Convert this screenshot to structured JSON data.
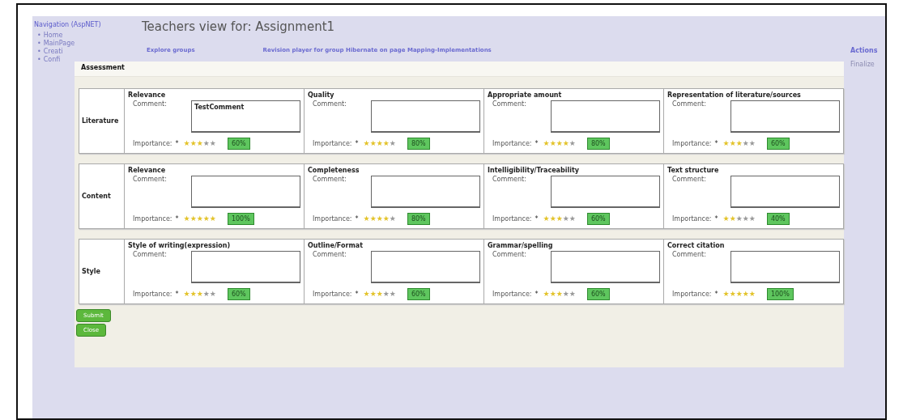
{
  "sidebar": {
    "title": "Navigation (AspNET)",
    "items": [
      {
        "bullet": "•",
        "label": "Home"
      },
      {
        "bullet": "•",
        "label": "MainPage"
      },
      {
        "bullet": "•",
        "label": "Creati"
      },
      {
        "bullet": "•",
        "label": "Confi"
      }
    ]
  },
  "page_title": "Teachers view for: Assignment1",
  "nav_links": [
    "Explore groups",
    "Revision player for group Hibernate on page Mapping-Implementations"
  ],
  "actions": {
    "title": "Actions",
    "items": [
      "Finalize"
    ]
  },
  "dialog": {
    "title": "Assessment",
    "rows": [
      {
        "category": "Literature",
        "criteria": [
          {
            "name": "Relevance",
            "comment_label": "Comment:",
            "comment": "TestComment",
            "importance_label": "Importance:",
            "required_mark": "*",
            "stars": 3,
            "percent": "60%"
          },
          {
            "name": "Quality",
            "comment_label": "Comment:",
            "importance_label": "Importance:",
            "required_mark": "*",
            "stars": 4,
            "percent": "80%"
          },
          {
            "name": "Appropriate amount",
            "comment_label": "Comment:",
            "importance_label": "Importance:",
            "required_mark": "*",
            "stars": 4,
            "percent": "80%"
          },
          {
            "name": "Representation of literature/sources",
            "comment_label": "Comment:",
            "importance_label": "Importance:",
            "required_mark": "*",
            "stars": 3,
            "percent": "60%"
          }
        ]
      },
      {
        "category": "Content",
        "criteria": [
          {
            "name": "Relevance",
            "comment_label": "Comment:",
            "importance_label": "Importance:",
            "required_mark": "*",
            "stars": 5,
            "percent": "100%"
          },
          {
            "name": "Completeness",
            "comment_label": "Comment:",
            "importance_label": "Importance:",
            "required_mark": "*",
            "stars": 4,
            "percent": "80%"
          },
          {
            "name": "Intelligibility/Traceability",
            "comment_label": "Comment:",
            "importance_label": "Importance:",
            "required_mark": "*",
            "stars": 3,
            "percent": "60%"
          },
          {
            "name": "Text structure",
            "comment_label": "Comment:",
            "importance_label": "Importance:",
            "required_mark": "*",
            "stars": 2,
            "percent": "40%"
          }
        ]
      },
      {
        "category": "Style",
        "criteria": [
          {
            "name": "Style of writing(expression)",
            "comment_label": "Comment:",
            "importance_label": "Importance:",
            "required_mark": "*",
            "stars": 3,
            "percent": "60%"
          },
          {
            "name": "Outline/Format",
            "comment_label": "Comment:",
            "importance_label": "Importance:",
            "required_mark": "*",
            "stars": 3,
            "percent": "60%"
          },
          {
            "name": "Grammar/spelling",
            "comment_label": "Comment:",
            "importance_label": "Importance:",
            "required_mark": "*",
            "stars": 3,
            "percent": "60%"
          },
          {
            "name": "Correct citation",
            "comment_label": "Comment:",
            "importance_label": "Importance:",
            "required_mark": "*",
            "stars": 5,
            "percent": "100%"
          }
        ]
      }
    ],
    "buttons": [
      "Submit",
      "Close"
    ]
  }
}
